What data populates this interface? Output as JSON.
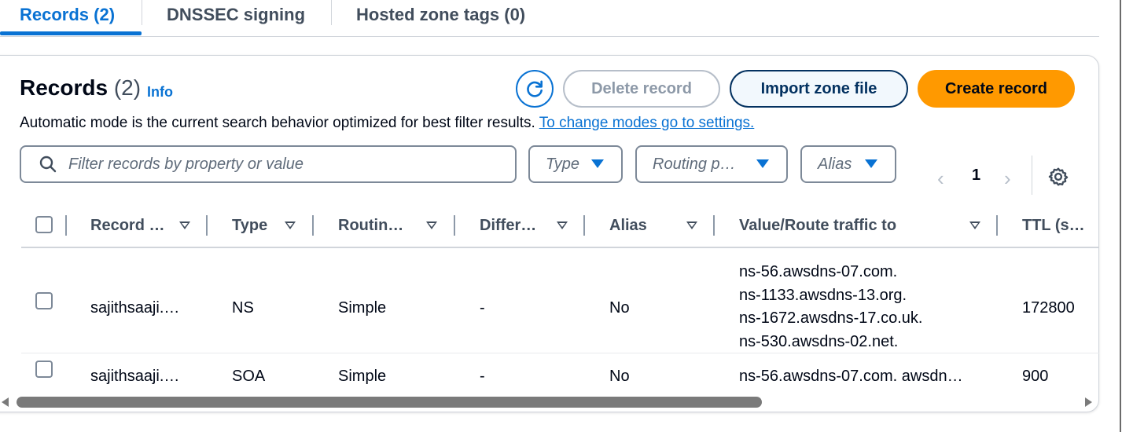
{
  "tabs": [
    {
      "label": "Records (2)",
      "active": true
    },
    {
      "label": "DNSSEC signing",
      "active": false
    },
    {
      "label": "Hosted zone tags (0)",
      "active": false
    }
  ],
  "header": {
    "title": "Records",
    "count": "(2)",
    "info": "Info"
  },
  "actions": {
    "refresh_icon": "refresh-icon",
    "delete": "Delete record",
    "import": "Import zone file",
    "create": "Create record"
  },
  "description": {
    "text": "Automatic mode is the current search behavior optimized for best filter results.",
    "link": "To change modes go to settings."
  },
  "filter": {
    "placeholder": "Filter records by property or value",
    "type": "Type",
    "routing": "Routing p…",
    "alias": "Alias"
  },
  "pagination": {
    "page": "1"
  },
  "columns": [
    "Record …",
    "Type",
    "Routin…",
    "Differ…",
    "Alias",
    "Value/Route traffic to",
    "TTL (s…"
  ],
  "rows": [
    {
      "name": "sajithsaaji.…",
      "type": "NS",
      "routing": "Simple",
      "differ": "-",
      "alias": "No",
      "values": [
        "ns-56.awsdns-07.com.",
        "ns-1133.awsdns-13.org.",
        "ns-1672.awsdns-17.co.uk.",
        "ns-530.awsdns-02.net."
      ],
      "ttl": "172800"
    },
    {
      "name": "sajithsaaji.…",
      "type": "SOA",
      "routing": "Simple",
      "differ": "-",
      "alias": "No",
      "values": [
        "ns-56.awsdns-07.com. awsdn…"
      ],
      "ttl": "900"
    }
  ],
  "colors": {
    "accent": "#0972d3",
    "primary_button": "#ff9900",
    "text": "#000716",
    "muted": "#414d5c"
  }
}
